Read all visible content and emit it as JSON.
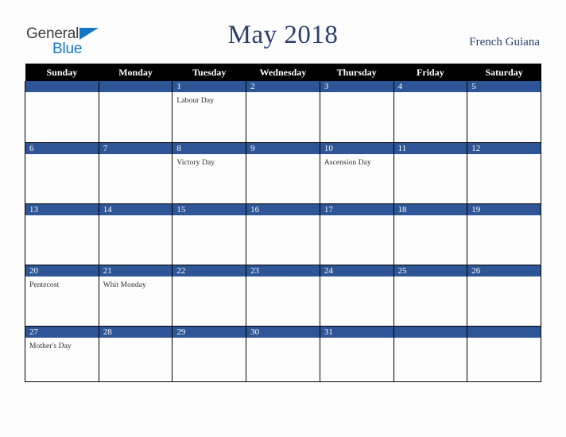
{
  "brand": {
    "name_part1": "General",
    "name_part2": "Blue",
    "triangle_icon": "triangle-icon",
    "color_dark": "#3b3b3b",
    "color_blue": "#1277c4"
  },
  "header": {
    "title": "May 2018",
    "locale": "French Guiana",
    "title_color": "#2b3f6c"
  },
  "colors": {
    "header_row_bg": "#000000",
    "header_row_text": "#ffffff",
    "daynum_bg": "#2e5595",
    "daynum_text": "#ffffff",
    "cell_bg": "#fdfdfd",
    "grid_line": "#000000",
    "page_bg": "#fdfdfd",
    "holiday_text": "#2b2b2b"
  },
  "weekdays": [
    "Sunday",
    "Monday",
    "Tuesday",
    "Wednesday",
    "Thursday",
    "Friday",
    "Saturday"
  ],
  "weeks": [
    [
      {
        "day": "",
        "holiday": ""
      },
      {
        "day": "",
        "holiday": ""
      },
      {
        "day": "1",
        "holiday": "Labour Day"
      },
      {
        "day": "2",
        "holiday": ""
      },
      {
        "day": "3",
        "holiday": ""
      },
      {
        "day": "4",
        "holiday": ""
      },
      {
        "day": "5",
        "holiday": ""
      }
    ],
    [
      {
        "day": "6",
        "holiday": ""
      },
      {
        "day": "7",
        "holiday": ""
      },
      {
        "day": "8",
        "holiday": "Victory Day"
      },
      {
        "day": "9",
        "holiday": ""
      },
      {
        "day": "10",
        "holiday": "Ascension Day"
      },
      {
        "day": "11",
        "holiday": ""
      },
      {
        "day": "12",
        "holiday": ""
      }
    ],
    [
      {
        "day": "13",
        "holiday": ""
      },
      {
        "day": "14",
        "holiday": ""
      },
      {
        "day": "15",
        "holiday": ""
      },
      {
        "day": "16",
        "holiday": ""
      },
      {
        "day": "17",
        "holiday": ""
      },
      {
        "day": "18",
        "holiday": ""
      },
      {
        "day": "19",
        "holiday": ""
      }
    ],
    [
      {
        "day": "20",
        "holiday": "Pentecost"
      },
      {
        "day": "21",
        "holiday": "Whit Monday"
      },
      {
        "day": "22",
        "holiday": ""
      },
      {
        "day": "23",
        "holiday": ""
      },
      {
        "day": "24",
        "holiday": ""
      },
      {
        "day": "25",
        "holiday": ""
      },
      {
        "day": "26",
        "holiday": ""
      }
    ],
    [
      {
        "day": "27",
        "holiday": "Mother's Day"
      },
      {
        "day": "28",
        "holiday": ""
      },
      {
        "day": "29",
        "holiday": ""
      },
      {
        "day": "30",
        "holiday": ""
      },
      {
        "day": "31",
        "holiday": ""
      },
      {
        "day": "",
        "holiday": ""
      },
      {
        "day": "",
        "holiday": ""
      }
    ]
  ]
}
